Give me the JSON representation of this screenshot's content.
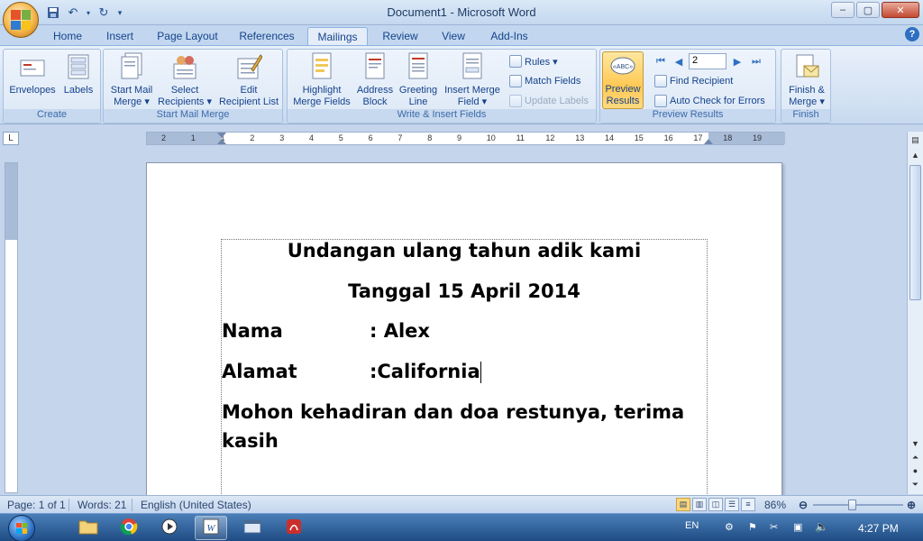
{
  "window": {
    "title": "Document1 - Microsoft Word",
    "controls": {
      "minimize": "–",
      "maximize": "▢",
      "close": "✕"
    }
  },
  "qat": {
    "save_icon": "save-icon",
    "undo_icon": "undo-icon",
    "redo_icon": "redo-icon"
  },
  "tabs": [
    {
      "label": "Home"
    },
    {
      "label": "Insert"
    },
    {
      "label": "Page Layout"
    },
    {
      "label": "References"
    },
    {
      "label": "Mailings",
      "active": true
    },
    {
      "label": "Review"
    },
    {
      "label": "View"
    },
    {
      "label": "Add-Ins"
    }
  ],
  "ribbon": {
    "create": {
      "label": "Create",
      "envelopes": "Envelopes",
      "labels": "Labels"
    },
    "start": {
      "label": "Start Mail Merge",
      "start_line1": "Start Mail",
      "start_line2": "Merge ▾",
      "select_line1": "Select",
      "select_line2": "Recipients ▾",
      "edit_line1": "Edit",
      "edit_line2": "Recipient List"
    },
    "write": {
      "label": "Write & Insert Fields",
      "highlight_line1": "Highlight",
      "highlight_line2": "Merge Fields",
      "address_line1": "Address",
      "address_line2": "Block",
      "greeting_line1": "Greeting",
      "greeting_line2": "Line",
      "insert_line1": "Insert Merge",
      "insert_line2": "Field ▾",
      "rules": "Rules ▾",
      "match_fields": "Match Fields",
      "update_labels": "Update Labels"
    },
    "preview": {
      "label": "Preview Results",
      "preview_line1": "Preview",
      "preview_line2": "Results",
      "record": "2",
      "find_recipient": "Find Recipient",
      "auto_check": "Auto Check for Errors"
    },
    "finish": {
      "label": "Finish",
      "finish_line1": "Finish &",
      "finish_line2": "Merge ▾"
    }
  },
  "ruler": {
    "corner": "L",
    "ticks": [
      "2",
      "1",
      "1",
      "2",
      "3",
      "4",
      "5",
      "6",
      "7",
      "8",
      "9",
      "10",
      "11",
      "12",
      "13",
      "14",
      "15",
      "16",
      "17",
      "18",
      "19"
    ]
  },
  "document": {
    "line1": "Undangan ulang tahun adik kami",
    "line2": "Tanggal 15 April 2014",
    "nama_label": "Nama",
    "nama_value": ": Alex",
    "alamat_label": "Alamat",
    "alamat_value": ":California",
    "closing_line1": "Mohon kehadiran dan doa restunya, terima",
    "closing_line2": "kasih"
  },
  "status": {
    "page": "Page: 1 of 1",
    "words": "Words: 21",
    "language": "English (United States)",
    "zoom": "86%",
    "zoom_level_percent": 86
  },
  "taskbar": {
    "language": "EN",
    "time": "4:27 PM"
  }
}
